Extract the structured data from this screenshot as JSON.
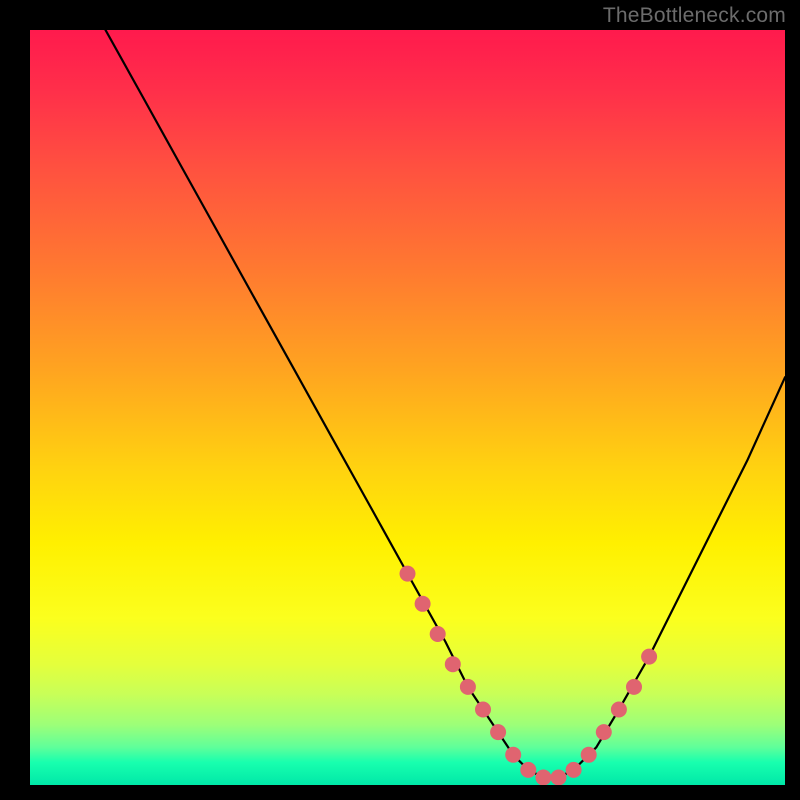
{
  "attribution": "TheBottleneck.com",
  "chart_data": {
    "type": "line",
    "title": "",
    "xlabel": "",
    "ylabel": "",
    "xlim": [
      0,
      100
    ],
    "ylim": [
      0,
      100
    ],
    "grid": false,
    "legend": false,
    "series": [
      {
        "name": "bottleneck-curve",
        "x": [
          10,
          15,
          20,
          25,
          30,
          35,
          40,
          45,
          50,
          55,
          58,
          60,
          62,
          64,
          66,
          68,
          70,
          72,
          75,
          78,
          82,
          86,
          90,
          95,
          100
        ],
        "y": [
          100,
          91,
          82,
          73,
          64,
          55,
          46,
          37,
          28,
          19,
          13,
          10,
          7,
          4,
          2,
          1,
          1,
          2,
          5,
          10,
          17,
          25,
          33,
          43,
          54
        ]
      }
    ],
    "markers": {
      "name": "highlighted-points",
      "x": [
        50,
        52,
        54,
        56,
        58,
        60,
        62,
        64,
        66,
        68,
        70,
        72,
        74,
        76,
        78,
        80,
        82
      ],
      "y": [
        28,
        24,
        20,
        16,
        13,
        10,
        7,
        4,
        2,
        1,
        1,
        2,
        4,
        7,
        10,
        13,
        17
      ]
    },
    "gradient_stops": [
      {
        "pos": 0,
        "color": "#ff1a4d"
      },
      {
        "pos": 18,
        "color": "#ff5040"
      },
      {
        "pos": 45,
        "color": "#ffa420"
      },
      {
        "pos": 68,
        "color": "#fff000"
      },
      {
        "pos": 88,
        "color": "#c8ff58"
      },
      {
        "pos": 97,
        "color": "#18ffae"
      },
      {
        "pos": 100,
        "color": "#00e8a8"
      }
    ]
  }
}
